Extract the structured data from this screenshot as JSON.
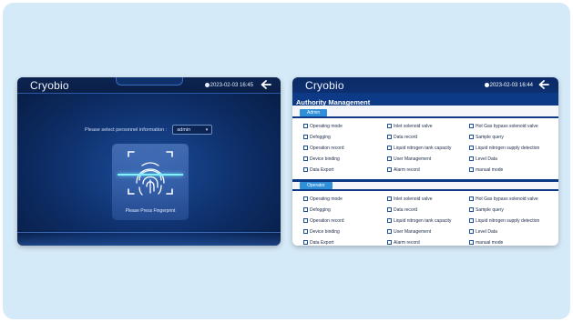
{
  "login_screen": {
    "brand": "Cryobio",
    "datetime": "2023-02-03 16:45",
    "prompt": "Please select personnel information :",
    "selected_user": "admin",
    "fingerprint_label": "Please Press Fingerprint"
  },
  "auth_screen": {
    "brand": "Cryobio",
    "datetime": "2023-02-03 16:44",
    "title": "Authority Management",
    "sections": [
      {
        "name": "Admin",
        "permissions": [
          "Operating mode",
          "Inlet solenoid valve",
          "Hot Gas bypass solenoid valve",
          "Defogging",
          "Data record",
          "Sample query",
          "Operation record",
          "Liquid nitrogen tank capacity",
          "Liquid nitrogen supply detection",
          "Device binding",
          "User Management",
          "Level Data",
          "Data Export",
          "Alarm record",
          "manual mode"
        ]
      },
      {
        "name": "Operator",
        "permissions": [
          "Operating mode",
          "Inlet solenoid valve",
          "Hot Gas bypass solenoid valve",
          "Defogging",
          "Data record",
          "Sample query",
          "Operation record",
          "Liquid nitrogen tank capacity",
          "Liquid nitrogen supply detection",
          "Device binding",
          "User Management",
          "Level Data",
          "Data Export",
          "Alarm record",
          "manual mode"
        ]
      }
    ]
  }
}
